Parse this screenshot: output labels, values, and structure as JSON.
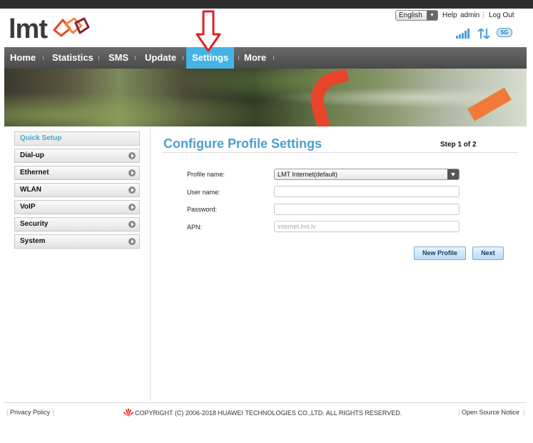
{
  "header": {
    "logo_text": "lmt",
    "language": "English",
    "help_label": "Help",
    "user_label": "admin",
    "logout_label": "Log Out",
    "network_badge": "5G"
  },
  "nav": {
    "items": [
      {
        "label": "Home"
      },
      {
        "label": "Statistics"
      },
      {
        "label": "SMS"
      },
      {
        "label": "Update"
      },
      {
        "label": "Settings"
      },
      {
        "label": "More"
      }
    ],
    "active": "Settings"
  },
  "sidebar": {
    "items": [
      {
        "label": "Quick Setup"
      },
      {
        "label": "Dial-up"
      },
      {
        "label": "Ethernet"
      },
      {
        "label": "WLAN"
      },
      {
        "label": "VoIP"
      },
      {
        "label": "Security"
      },
      {
        "label": "System"
      }
    ]
  },
  "main": {
    "title": "Configure Profile Settings",
    "step": "Step 1 of 2",
    "form": {
      "profile_name_label": "Profile name:",
      "profile_name_value": "LMT Internet(default)",
      "user_name_label": "User name:",
      "user_name_value": "",
      "password_label": "Password:",
      "password_value": "",
      "apn_label": "APN:",
      "apn_value": "internet.lmt.lv"
    },
    "new_profile_label": "New Profile",
    "next_label": "Next"
  },
  "footer": {
    "privacy_label": "Privacy Policy",
    "copyright": "COPYRIGHT (C) 2006-2018 HUAWEI TECHNOLOGIES CO.,LTD. ALL RIGHTS RESERVED.",
    "open_source_label": "Open Source Notice"
  },
  "colors": {
    "accent": "#45b4e4",
    "title": "#4aa0cf",
    "annotation_arrow": "#e02020",
    "brand_red": "#e8442a"
  }
}
